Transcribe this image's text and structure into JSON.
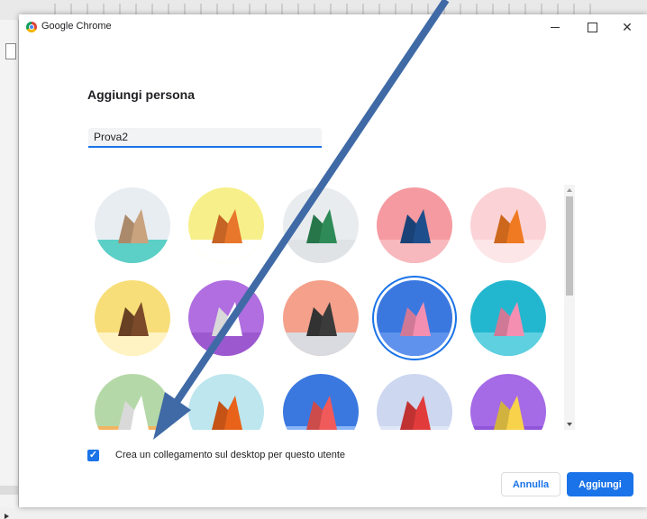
{
  "window": {
    "app_name": "Google Chrome",
    "minimize_icon": "minimize-icon",
    "maximize_icon": "maximize-icon",
    "close_icon": "close-icon",
    "close_glyph": "✕"
  },
  "dialog": {
    "title": "Aggiungi persona",
    "name_value": "Prova2",
    "avatars": [
      {
        "id": "cat",
        "bg": "#e8edf2",
        "accent": "#5ccfc6",
        "fg": "#c9a27e"
      },
      {
        "id": "corgi",
        "bg": "#f7f08a",
        "accent": "#ffffff",
        "fg": "#e8762b"
      },
      {
        "id": "dragon",
        "bg": "#e9ecef",
        "accent": "#dfe3e6",
        "fg": "#2e8b57"
      },
      {
        "id": "elephant",
        "bg": "#f59aa0",
        "accent": "#f7b9bd",
        "fg": "#1f4e8c"
      },
      {
        "id": "fox",
        "bg": "#fbd3d6",
        "accent": "#fde6e8",
        "fg": "#f07a22"
      },
      {
        "id": "monkey",
        "bg": "#f8de78",
        "accent": "#fff3c4",
        "fg": "#7a4a2a"
      },
      {
        "id": "panda",
        "bg": "#b06ee0",
        "accent": "#9c58cf",
        "fg": "#ffffff"
      },
      {
        "id": "penguin",
        "bg": "#f5a08b",
        "accent": "#d9dbe0",
        "fg": "#3b3b3b"
      },
      {
        "id": "butterfly",
        "bg": "#3a78e0",
        "accent": "#5f92ec",
        "fg": "#f48fb1"
      },
      {
        "id": "rabbit",
        "bg": "#23b7cf",
        "accent": "#5fd0e0",
        "fg": "#f48fb1"
      },
      {
        "id": "unicorn",
        "bg": "#b5d8a8",
        "accent": "#f3b562",
        "fg": "#ffffff"
      },
      {
        "id": "basketball",
        "bg": "#bde6ee",
        "accent": "#bde6ee",
        "fg": "#e8621a"
      },
      {
        "id": "bike",
        "bg": "#3a78e0",
        "accent": "#8ab4f8",
        "fg": "#f05a5a"
      },
      {
        "id": "bird",
        "bg": "#cdd7f0",
        "accent": "#dfe6f6",
        "fg": "#e23b3b"
      },
      {
        "id": "cheese",
        "bg": "#a56ae6",
        "accent": "#9055d8",
        "fg": "#f7d24a"
      }
    ],
    "selected_avatar": "butterfly",
    "shortcut_checked": true,
    "shortcut_label": "Crea un collegamento sul desktop per questo utente",
    "check_glyph": "✓",
    "cancel_label": "Annulla",
    "add_label": "Aggiungi"
  },
  "colors": {
    "accent": "#1a73e8",
    "annotation_arrow": "#3f6aa6"
  }
}
